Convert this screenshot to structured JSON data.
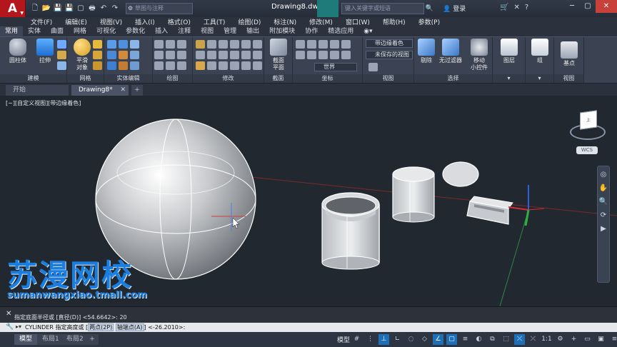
{
  "titlebar": {
    "logo": "A",
    "workspace_placeholder": "草图与注释",
    "title": "Drawing8.dwg",
    "search_placeholder": "键入关键字或短语",
    "login": "登录"
  },
  "menu": [
    "文件(F)",
    "编辑(E)",
    "视图(V)",
    "插入(I)",
    "格式(O)",
    "工具(T)",
    "绘图(D)",
    "标注(N)",
    "修改(M)",
    "窗口(W)",
    "帮助(H)",
    "参数(P)"
  ],
  "ribbon_tabs": [
    "常用",
    "实体",
    "曲面",
    "网格",
    "可视化",
    "参数化",
    "插入",
    "注释",
    "视图",
    "管理",
    "输出",
    "附加模块",
    "协作",
    "精选应用"
  ],
  "ribbon": {
    "cylinder_label": "圆柱体",
    "extrude_label": "拉伸",
    "smooth_label": "平滑\n对象",
    "section_plane_label": "截面\n平面",
    "visual_style_value": "带边缘着色",
    "saved_view_value": "未保存的视图",
    "world_value": "世界",
    "cull_label": "剔除",
    "no_filter_label": "无过滤器",
    "gizmo_label": "移动\n小控件",
    "layers_label": "图层",
    "group_label": "组",
    "base_label": "基点",
    "panels": {
      "modeling": "建模",
      "mesh": "网格",
      "solid_edit": "实体编辑",
      "draw": "绘图",
      "modify": "修改",
      "section": "截面",
      "coordinates": "坐标",
      "view": "视图",
      "selection": "选择",
      "view2": "视图"
    }
  },
  "doc_tabs": {
    "start": "开始",
    "active": "Drawing8*"
  },
  "viewport": {
    "label": "[−][自定义视图][带边缘着色]",
    "viewcube_face": "上",
    "wcs": "WCS"
  },
  "watermark": {
    "title": "苏漫网校",
    "url": "sumanwangxiao.tmall.com"
  },
  "command": {
    "history_line": "指定底面半径或 [直径(D)] <54.6642>: 20",
    "prompt_prefix": "CYLINDER 指定高度或 [",
    "opt1": "两点(2P)",
    "opt2": "轴端点(A)",
    "prompt_suffix": "] <-26.2010>:"
  },
  "status": {
    "tabs": [
      "模型",
      "布局1",
      "布局2"
    ],
    "model_label": "模型",
    "scale": "1:1"
  },
  "colors": {
    "accent": "#1d6fb8",
    "watermark": "#1a7ee0",
    "grid_red": "#8a2a2a",
    "axis_green": "#2aa84a"
  }
}
